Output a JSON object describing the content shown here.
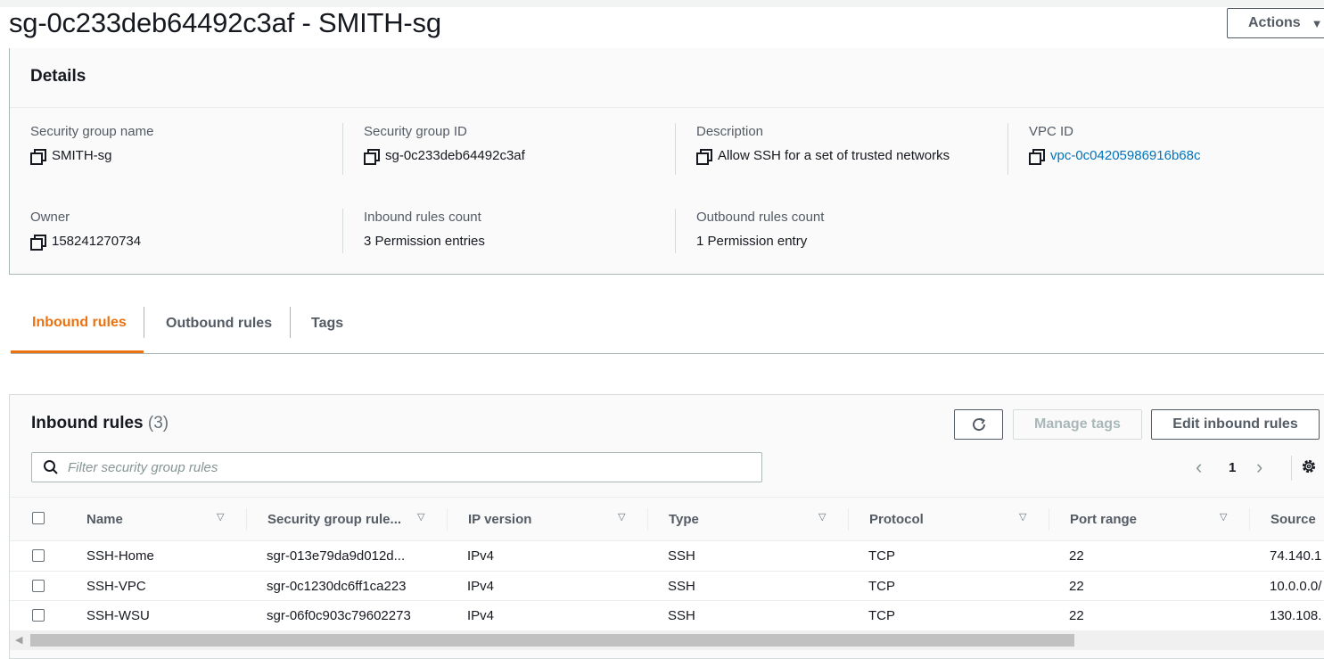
{
  "page": {
    "title": "sg-0c233deb64492c3af - SMITH-sg",
    "actions_label": "Actions",
    "actions_caret": "▼"
  },
  "details": {
    "heading": "Details",
    "fields": {
      "sg_name": {
        "label": "Security group name",
        "value": "SMITH-sg"
      },
      "sg_id": {
        "label": "Security group ID",
        "value": "sg-0c233deb64492c3af"
      },
      "description": {
        "label": "Description",
        "value": "Allow SSH for a set of trusted networks"
      },
      "vpc_id": {
        "label": "VPC ID",
        "value": "vpc-0c04205986916b68c"
      },
      "owner": {
        "label": "Owner",
        "value": "158241270734"
      },
      "inbound_count": {
        "label": "Inbound rules count",
        "value": "3 Permission entries"
      },
      "outbound_count": {
        "label": "Outbound rules count",
        "value": "1 Permission entry"
      }
    }
  },
  "tabs": [
    {
      "label": "Inbound rules",
      "active": true
    },
    {
      "label": "Outbound rules",
      "active": false
    },
    {
      "label": "Tags",
      "active": false
    }
  ],
  "inbound": {
    "title": "Inbound rules",
    "count": "(3)",
    "manage_tags_label": "Manage tags",
    "edit_label": "Edit inbound rules",
    "search_placeholder": "Filter security group rules",
    "page": "1",
    "prev": "‹",
    "next": "›",
    "columns": [
      "Name",
      "Security group rule...",
      "IP version",
      "Type",
      "Protocol",
      "Port range",
      "Source"
    ],
    "rows": [
      {
        "name": "SSH-Home",
        "rule_id": "sgr-013e79da9d012d...",
        "ip_version": "IPv4",
        "type": "SSH",
        "protocol": "TCP",
        "port_range": "22",
        "source": "74.140.1"
      },
      {
        "name": "SSH-VPC",
        "rule_id": "sgr-0c1230dc6ff1ca223",
        "ip_version": "IPv4",
        "type": "SSH",
        "protocol": "TCP",
        "port_range": "22",
        "source": "10.0.0.0/"
      },
      {
        "name": "SSH-WSU",
        "rule_id": "sgr-06f0c903c79602273",
        "ip_version": "IPv4",
        "type": "SSH",
        "protocol": "TCP",
        "port_range": "22",
        "source": "130.108."
      }
    ],
    "scroll_arrow": "◀"
  },
  "colors": {
    "accent": "#ec7211",
    "link": "#0073bb",
    "text": "#16191f",
    "muted": "#545b64"
  },
  "icons": [
    "copy-icon",
    "refresh-icon",
    "search-icon",
    "settings-gear-icon",
    "sort-caret-icon",
    "chevron-left-icon",
    "chevron-right-icon"
  ]
}
